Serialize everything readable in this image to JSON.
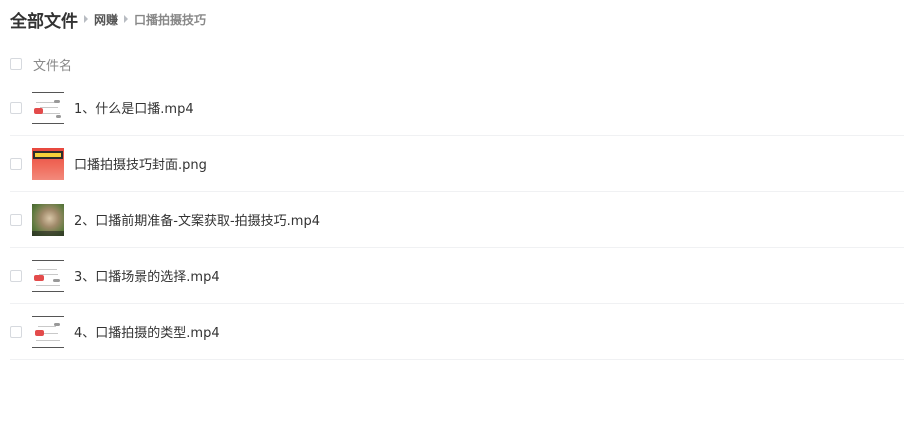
{
  "breadcrumb": {
    "root": "全部文件",
    "middle": "网赚",
    "current": "口播拍摄技巧"
  },
  "list_header": {
    "column_label": "文件名"
  },
  "files": [
    {
      "name": "1、什么是口播.mp4",
      "thumb": "mindmap-thumbnail"
    },
    {
      "name": "口播拍摄技巧封面.png",
      "thumb": "cover-thumbnail"
    },
    {
      "name": "2、口播前期准备-文案获取-拍摄技巧.mp4",
      "thumb": "photo-thumbnail"
    },
    {
      "name": "3、口播场景的选择.mp4",
      "thumb": "mindmap-thumbnail"
    },
    {
      "name": "4、口播拍摄的类型.mp4",
      "thumb": "mindmap-thumbnail"
    }
  ],
  "colors": {
    "text": "#333333",
    "muted": "#888888",
    "divider": "#f0f1f3",
    "checkbox_border": "#d6d9de"
  }
}
